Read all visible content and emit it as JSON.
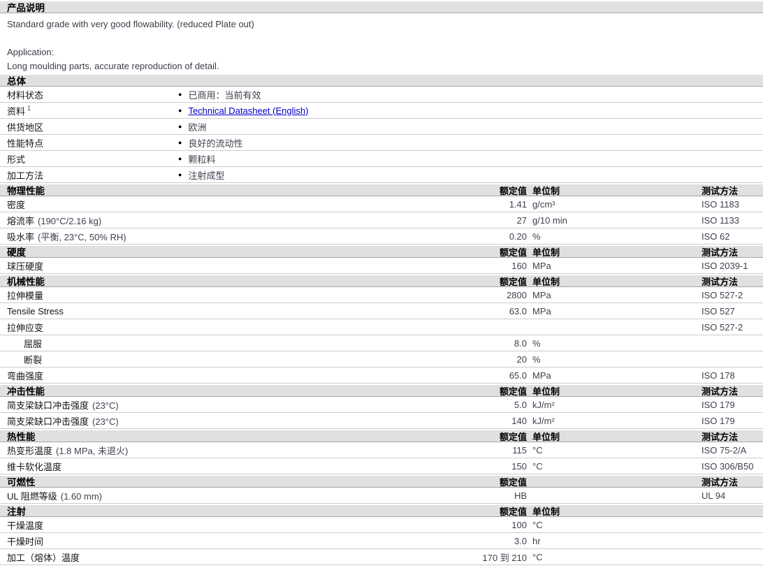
{
  "page": {
    "product_header": "产品说明",
    "description": "Standard grade with very good flowability. (reduced Plate out)",
    "application_label": "Application:",
    "application_text": "Long moulding parts, accurate reproduction of detail."
  },
  "general": {
    "title": "总体",
    "bullet_glyph": "●",
    "rows": [
      {
        "label": "材料状态",
        "sup": "",
        "value": "已商用：当前有效",
        "is_link": false
      },
      {
        "label": "资料",
        "sup": "1",
        "value": "Technical Datasheet (English)",
        "is_link": true
      },
      {
        "label": "供货地区",
        "sup": "",
        "value": "欧洲",
        "is_link": false
      },
      {
        "label": "性能特点",
        "sup": "",
        "value": "良好的流动性",
        "is_link": false
      },
      {
        "label": "形式",
        "sup": "",
        "value": "颗粒料",
        "is_link": false
      },
      {
        "label": "加工方法",
        "sup": "",
        "value": "注射成型",
        "is_link": false
      }
    ]
  },
  "property_sections": [
    {
      "title": "物理性能",
      "header_value": "额定值",
      "header_unit": "单位制",
      "header_test": "测试方法",
      "rows": [
        {
          "label": "密度",
          "cond": "",
          "value": "1.41",
          "unit": "g/cm³",
          "test": "ISO 1183",
          "indent": false
        },
        {
          "label": "熔流率",
          "cond": "(190°C/2.16 kg)",
          "value": "27",
          "unit": "g/10 min",
          "test": "ISO 1133",
          "indent": false
        },
        {
          "label": "吸水率",
          "cond": "(平衡, 23°C, 50% RH)",
          "value": "0.20",
          "unit": "%",
          "test": "ISO 62",
          "indent": false
        }
      ]
    },
    {
      "title": "硬度",
      "header_value": "额定值",
      "header_unit": "单位制",
      "header_test": "测试方法",
      "rows": [
        {
          "label": "球压硬度",
          "cond": "",
          "value": "160",
          "unit": "MPa",
          "test": "ISO 2039-1",
          "indent": false
        }
      ]
    },
    {
      "title": "机械性能",
      "header_value": "额定值",
      "header_unit": "单位制",
      "header_test": "测试方法",
      "rows": [
        {
          "label": "拉伸模量",
          "cond": "",
          "value": "2800",
          "unit": "MPa",
          "test": "ISO 527-2",
          "indent": false
        },
        {
          "label": "Tensile Stress",
          "cond": "",
          "value": "63.0",
          "unit": "MPa",
          "test": "ISO 527",
          "indent": false
        },
        {
          "label": "拉伸应变",
          "cond": "",
          "value": "",
          "unit": "",
          "test": "ISO 527-2",
          "indent": false
        },
        {
          "label": "屈服",
          "cond": "",
          "value": "8.0",
          "unit": "%",
          "test": "",
          "indent": true
        },
        {
          "label": "断裂",
          "cond": "",
          "value": "20",
          "unit": "%",
          "test": "",
          "indent": true
        },
        {
          "label": "弯曲强度",
          "cond": "",
          "value": "65.0",
          "unit": "MPa",
          "test": "ISO 178",
          "indent": false
        }
      ]
    },
    {
      "title": "冲击性能",
      "header_value": "额定值",
      "header_unit": "单位制",
      "header_test": "测试方法",
      "rows": [
        {
          "label": "简支梁缺口冲击强度",
          "cond": "(23°C)",
          "value": "5.0",
          "unit": "kJ/m²",
          "test": "ISO 179",
          "indent": false
        },
        {
          "label": "简支梁缺口冲击强度",
          "cond": "(23°C)",
          "value": "140",
          "unit": "kJ/m²",
          "test": "ISO 179",
          "indent": false
        }
      ]
    },
    {
      "title": "热性能",
      "header_value": "额定值",
      "header_unit": "单位制",
      "header_test": "测试方法",
      "rows": [
        {
          "label": "热变形温度",
          "cond": "(1.8 MPa, 未退火)",
          "value": "115",
          "unit": "°C",
          "test": "ISO 75-2/A",
          "indent": false
        },
        {
          "label": "维卡软化温度",
          "cond": "",
          "value": "150",
          "unit": "°C",
          "test": "ISO 306/B50",
          "indent": false
        }
      ]
    },
    {
      "title": "可燃性",
      "header_value": "额定值",
      "header_unit": "",
      "header_test": "测试方法",
      "rows": [
        {
          "label": "UL 阻燃等级",
          "cond": "(1.60 mm)",
          "value": "HB",
          "unit": "",
          "test": "UL 94",
          "indent": false
        }
      ]
    },
    {
      "title": "注射",
      "header_value": "额定值",
      "header_unit": "单位制",
      "header_test": "",
      "rows": [
        {
          "label": "干燥温度",
          "cond": "",
          "value": "100",
          "unit": "°C",
          "test": "",
          "indent": false
        },
        {
          "label": "干燥时间",
          "cond": "",
          "value": "3.0",
          "unit": "hr",
          "test": "",
          "indent": false
        },
        {
          "label": "加工（熔体）温度",
          "cond": "",
          "value": "170 到 210",
          "unit": "°C",
          "test": "",
          "indent": false
        }
      ]
    }
  ]
}
